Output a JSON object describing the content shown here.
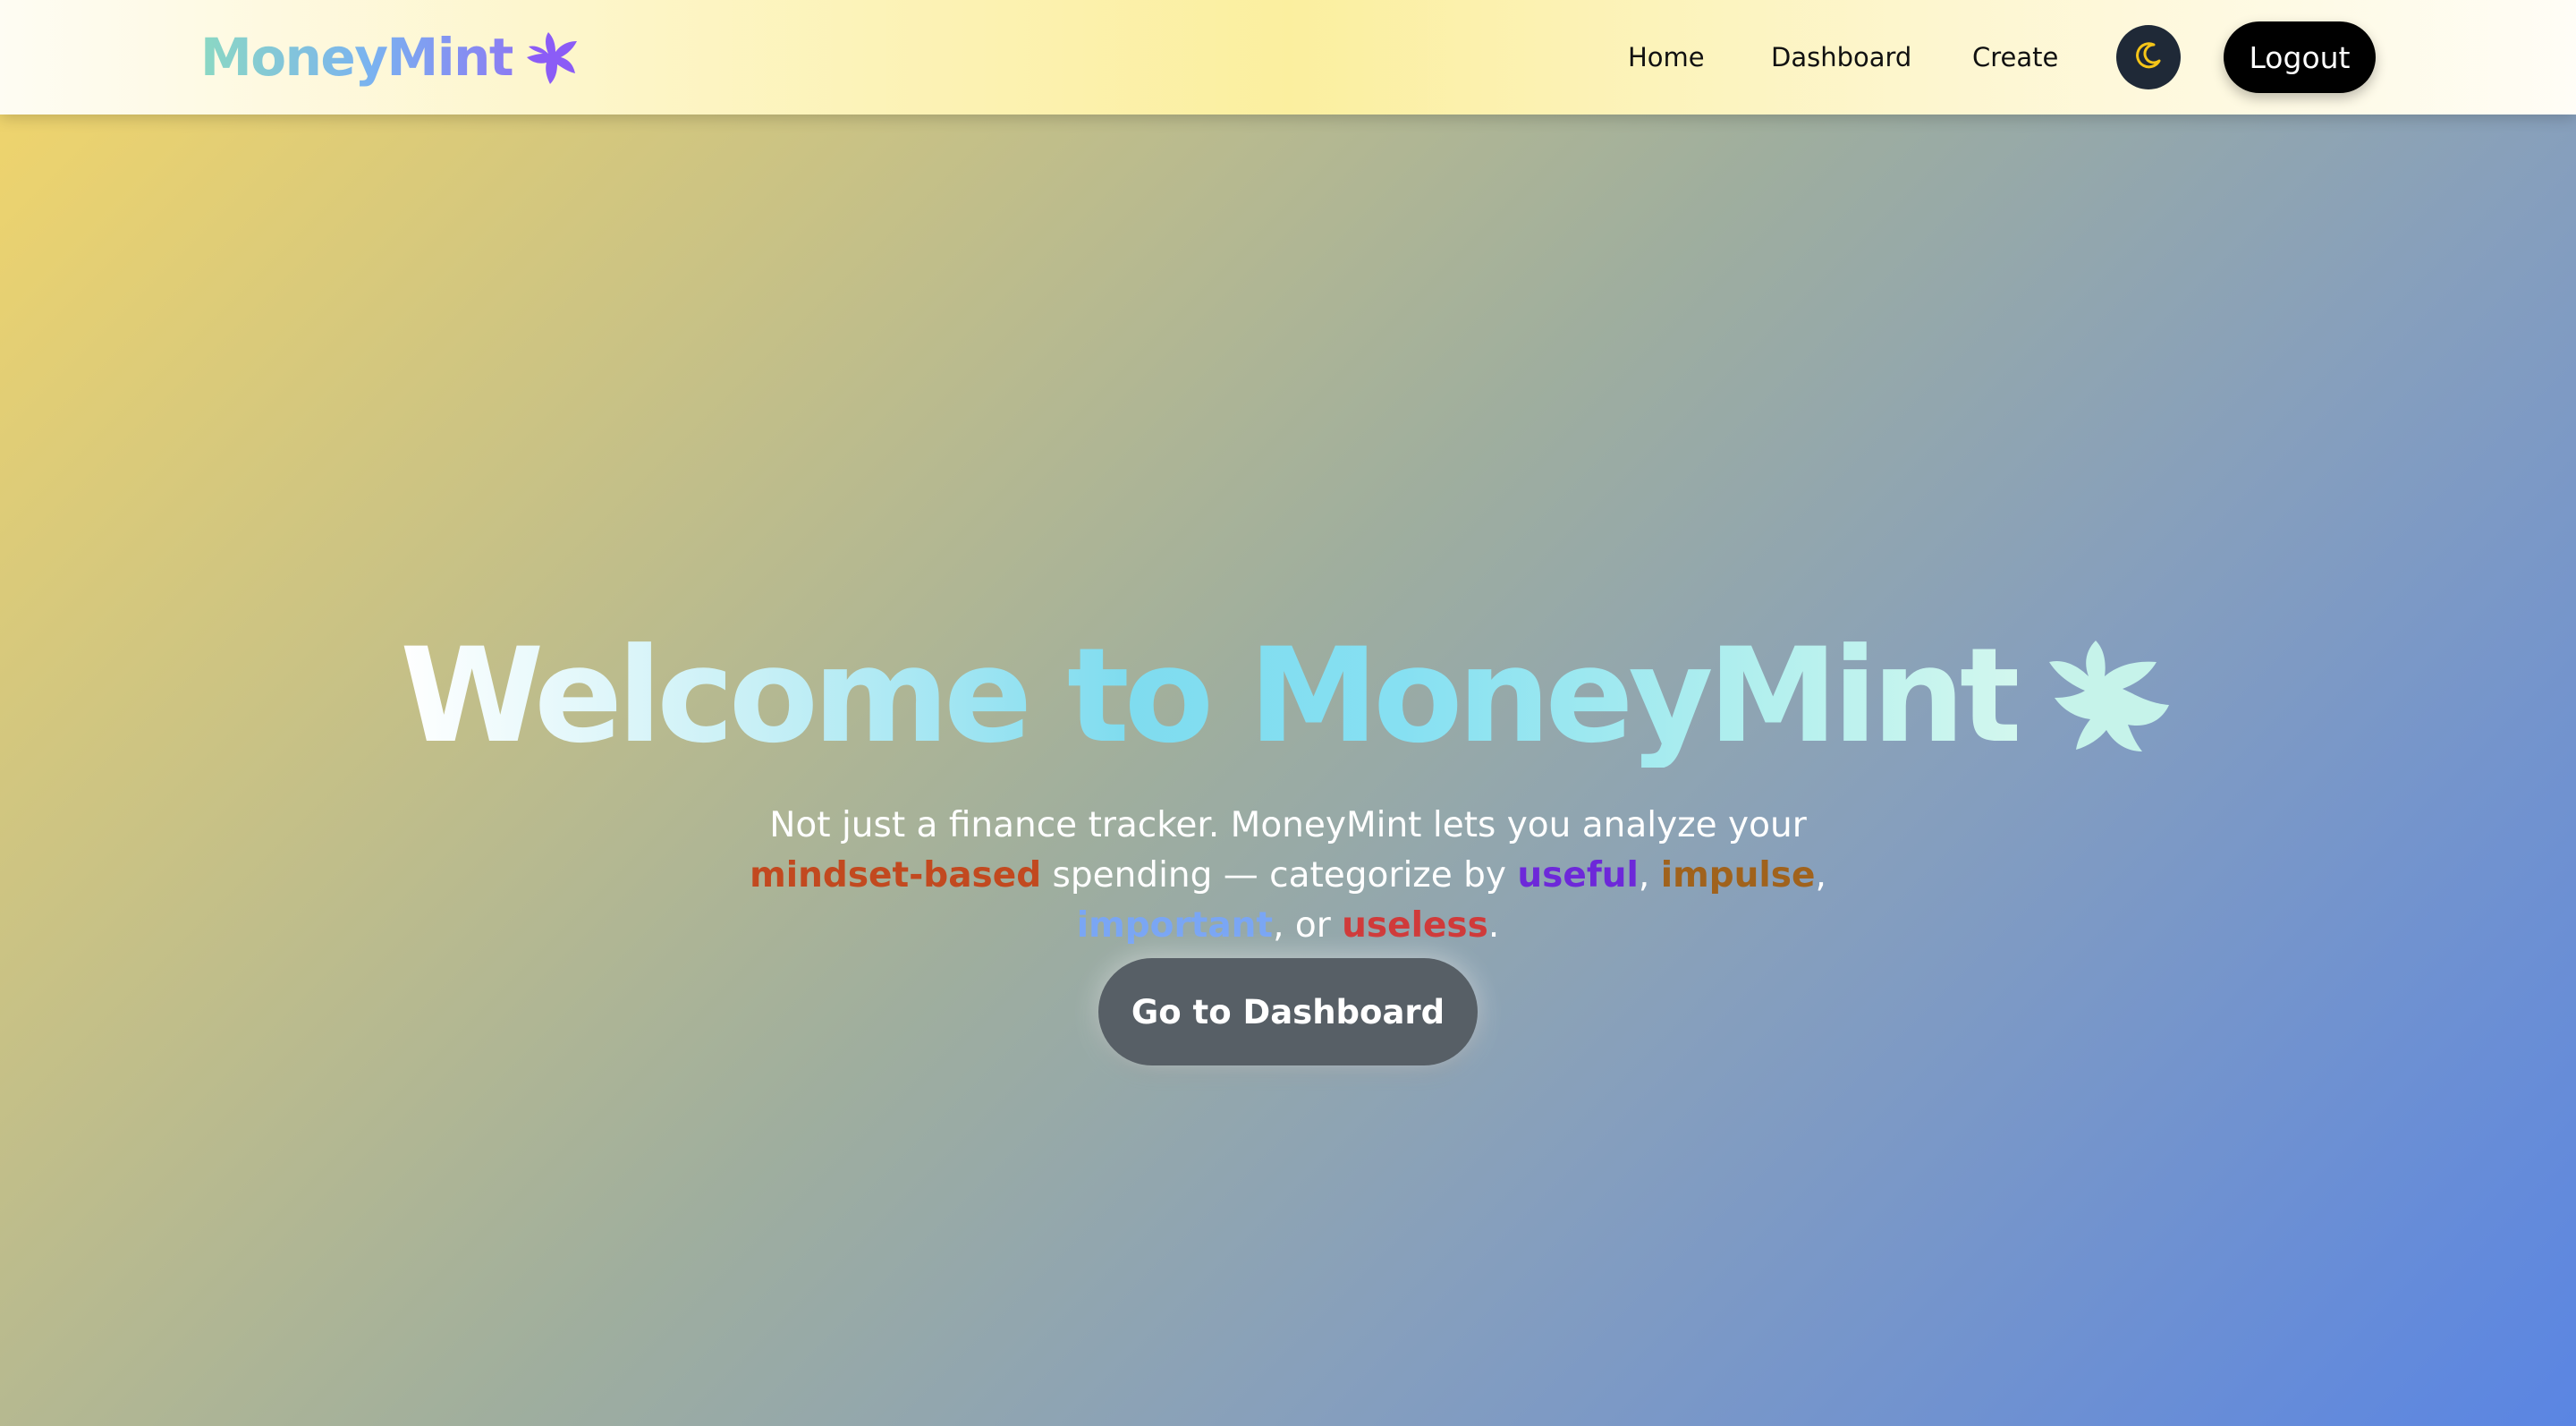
{
  "navbar": {
    "brand": "MoneyMint",
    "brand_icon": "dove-icon",
    "links": {
      "home": "Home",
      "dashboard": "Dashboard",
      "create": "Create"
    },
    "theme_toggle_icon": "moon-icon",
    "logout_label": "Logout"
  },
  "hero": {
    "title": "Welcome to MoneyMint",
    "title_icon": "dove-icon",
    "subtitle": {
      "part1": "Not just a finance tracker. MoneyMint lets you analyze your ",
      "highlight_mindset": "mindset-based",
      "part2": " spending — categorize by ",
      "useful": "useful",
      "sep1": ", ",
      "impulse": "impulse",
      "sep2": ", ",
      "important": "important",
      "sep3": ", or ",
      "useless": "useless",
      "end": "."
    },
    "cta_label": "Go to Dashboard"
  },
  "colors": {
    "mindset": "#c2491f",
    "useful": "#6d28d9",
    "impulse": "#a0621c",
    "important": "#7aa6f4",
    "useless": "#d03a3a",
    "logout_bg": "#000000",
    "toggle_bg": "#1f2937",
    "cta_bg": "#575f66"
  }
}
